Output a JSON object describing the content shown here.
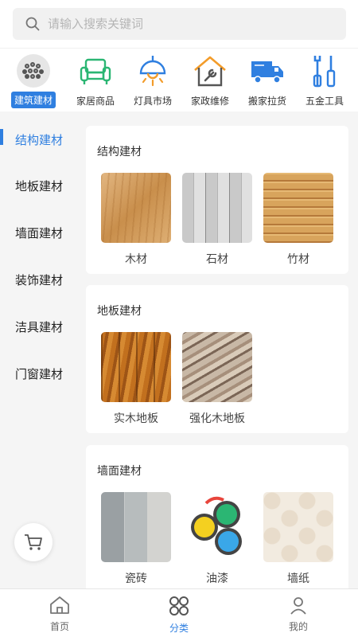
{
  "search": {
    "placeholder": "请输入搜索关键词"
  },
  "categories": [
    {
      "label": "建筑建材",
      "icon": "rebar-bundle-icon",
      "active": true
    },
    {
      "label": "家居商品",
      "icon": "sofa-icon"
    },
    {
      "label": "灯具市场",
      "icon": "lamp-icon"
    },
    {
      "label": "家政维修",
      "icon": "house-wrench-icon"
    },
    {
      "label": "搬家拉货",
      "icon": "truck-icon"
    },
    {
      "label": "五金工具",
      "icon": "tools-icon"
    }
  ],
  "sidebar": {
    "items": [
      {
        "label": "结构建材",
        "active": true
      },
      {
        "label": "地板建材"
      },
      {
        "label": "墙面建材"
      },
      {
        "label": "装饰建材"
      },
      {
        "label": "洁具建材"
      },
      {
        "label": "门窗建材"
      }
    ]
  },
  "sections": [
    {
      "title": "结构建材",
      "items": [
        {
          "label": "木材"
        },
        {
          "label": "石材"
        },
        {
          "label": "竹材"
        }
      ]
    },
    {
      "title": "地板建材",
      "items": [
        {
          "label": "实木地板"
        },
        {
          "label": "强化木地板"
        }
      ]
    },
    {
      "title": "墙面建材",
      "items": [
        {
          "label": "瓷砖"
        },
        {
          "label": "油漆"
        },
        {
          "label": "墙纸"
        }
      ]
    }
  ],
  "bottom_nav": {
    "tabs": [
      {
        "label": "首页",
        "icon": "home-icon"
      },
      {
        "label": "分类",
        "icon": "category-icon",
        "active": true
      },
      {
        "label": "我的",
        "icon": "user-icon"
      }
    ]
  },
  "colors": {
    "accent": "#2f7fe0",
    "icon_green": "#2bb673",
    "icon_orange": "#f39c2a",
    "icon_blue": "#2f7fe0"
  }
}
